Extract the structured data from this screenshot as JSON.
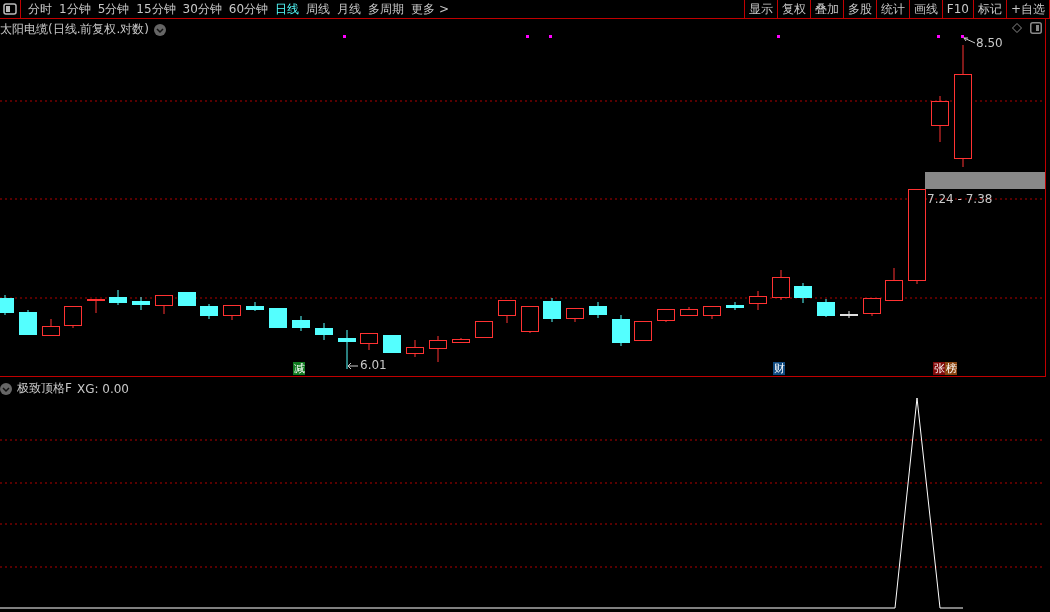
{
  "toolbar": {
    "periods": [
      {
        "label": "分时",
        "selected": false
      },
      {
        "label": "1分钟",
        "selected": false
      },
      {
        "label": "5分钟",
        "selected": false
      },
      {
        "label": "15分钟",
        "selected": false
      },
      {
        "label": "30分钟",
        "selected": false
      },
      {
        "label": "60分钟",
        "selected": false
      },
      {
        "label": "日线",
        "selected": true
      },
      {
        "label": "周线",
        "selected": false
      },
      {
        "label": "月线",
        "selected": false
      },
      {
        "label": "多周期",
        "selected": false
      },
      {
        "label": "更多 >",
        "selected": false
      }
    ],
    "tools": [
      "显示",
      "复权",
      "叠加",
      "多股",
      "统计",
      "画线",
      "F10",
      "标记",
      "+自选"
    ]
  },
  "main_chart": {
    "title": "太阳电缆(日线.前复权.对数)",
    "high_label": "8.50",
    "low_label": "6.01",
    "range_label": "7.24 - 7.38",
    "markers": [
      {
        "text": "减",
        "color": "#107a20"
      },
      {
        "text": "财",
        "color": "#104a80"
      },
      {
        "text": "张",
        "color": "#800a0a"
      },
      {
        "text": "榜",
        "color": "#8a4410"
      }
    ]
  },
  "indicator": {
    "title": "极致顶格F",
    "value_label": "XG: 0.00"
  }
}
